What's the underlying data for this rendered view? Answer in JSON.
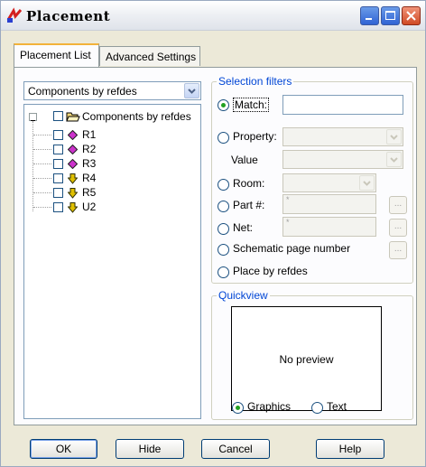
{
  "window": {
    "title": "Placement"
  },
  "tabs": [
    {
      "label": "Placement List"
    },
    {
      "label": "Advanced Settings"
    }
  ],
  "list": {
    "filter_selected": "Components by refdes",
    "root_label": "Components by refdes",
    "items": [
      {
        "label": "R1",
        "icon": "resistor-diamond-icon",
        "color": "#cc33cc"
      },
      {
        "label": "R2",
        "icon": "resistor-diamond-icon",
        "color": "#cc33cc"
      },
      {
        "label": "R3",
        "icon": "resistor-diamond-icon",
        "color": "#cc33cc"
      },
      {
        "label": "R4",
        "icon": "down-arrow-icon",
        "color": "#e0c000"
      },
      {
        "label": "R5",
        "icon": "down-arrow-icon",
        "color": "#e0c000"
      },
      {
        "label": "U2",
        "icon": "down-arrow-icon",
        "color": "#e0c000"
      }
    ]
  },
  "selection_filters": {
    "title": "Selection filters",
    "match_label": "Match:",
    "match_value": "",
    "property_label": "Property:",
    "value_label": "Value",
    "room_label": "Room:",
    "part_label": "Part #:",
    "part_value": "*",
    "net_label": "Net:",
    "net_value": "*",
    "schematic_label": "Schematic page number",
    "refdes_label": "Place by refdes",
    "browse_label": "..."
  },
  "quickview": {
    "title": "Quickview",
    "preview_text": "No preview",
    "graphics_label": "Graphics",
    "text_label": "Text"
  },
  "buttons": {
    "ok": "OK",
    "hide": "Hide",
    "cancel": "Cancel",
    "help": "Help"
  }
}
